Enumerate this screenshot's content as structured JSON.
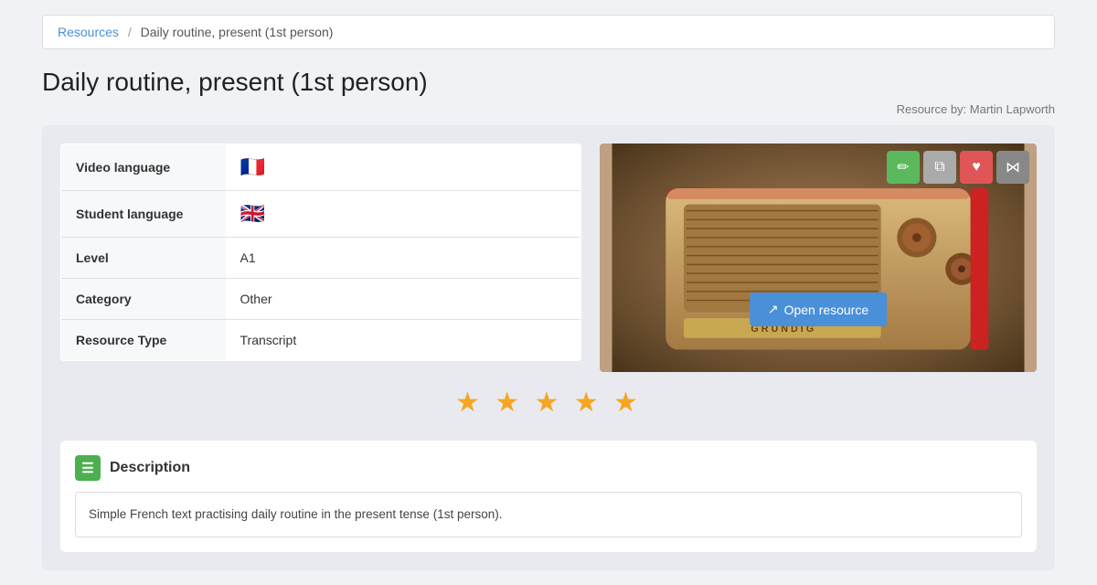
{
  "breadcrumb": {
    "link_label": "Resources",
    "separator": "/",
    "current": "Daily routine, present (1st person)"
  },
  "page_title": "Daily routine, present (1st person)",
  "resource_by": "Resource by: Martin Lapworth",
  "info_table": {
    "rows": [
      {
        "label": "Video language",
        "value": "🇫🇷",
        "type": "flag"
      },
      {
        "label": "Student language",
        "value": "🇬🇧",
        "type": "flag"
      },
      {
        "label": "Level",
        "value": "A1",
        "type": "text"
      },
      {
        "label": "Category",
        "value": "Other",
        "type": "text"
      },
      {
        "label": "Resource Type",
        "value": "Transcript",
        "type": "text"
      }
    ]
  },
  "toolbar": {
    "edit_icon": "✏",
    "copy_icon": "⧉",
    "heart_icon": "♥",
    "share_icon": "⋈"
  },
  "open_resource_btn": "Open resource",
  "stars": [
    "★",
    "★",
    "★",
    "★",
    "★"
  ],
  "description": {
    "header": "Description",
    "text": "Simple French text practising daily routine in the present tense (1st person)."
  }
}
